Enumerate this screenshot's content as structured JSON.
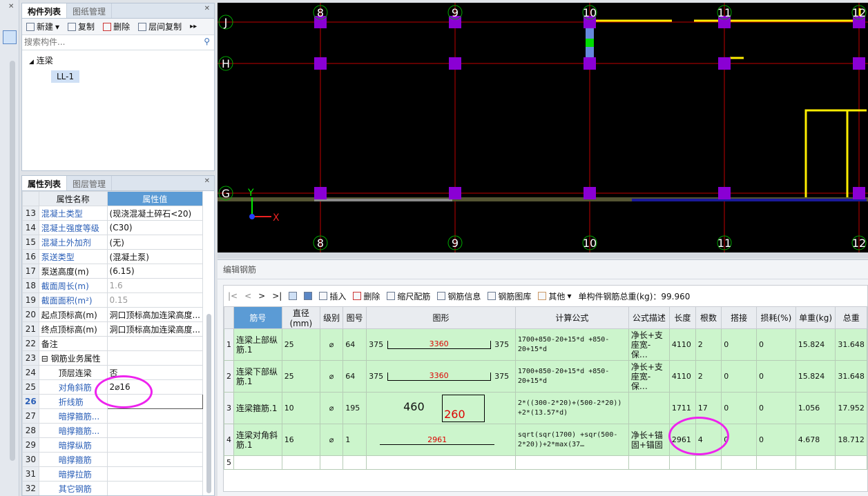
{
  "top_strip": {
    "close_label": "✕"
  },
  "component_panel": {
    "tabs": [
      "构件列表",
      "图纸管理"
    ],
    "toolbar": {
      "new": "新建",
      "copy": "复制",
      "delete": "删除",
      "floor_copy": "层间复制"
    },
    "search_placeholder": "搜索构件...",
    "tree": {
      "root": "连梁",
      "child": "LL-1"
    }
  },
  "property_panel": {
    "tabs": [
      "属性列表",
      "图层管理"
    ],
    "headers": [
      "属性名称",
      "属性值"
    ],
    "rows": [
      {
        "n": "13",
        "name": "混凝土类型",
        "value": "(现浇混凝土碎石<20)"
      },
      {
        "n": "14",
        "name": "混凝土强度等级",
        "value": "(C30)"
      },
      {
        "n": "15",
        "name": "混凝土外加剂",
        "value": "(无)"
      },
      {
        "n": "16",
        "name": "泵送类型",
        "value": "(混凝土泵)"
      },
      {
        "n": "17",
        "name": "泵送高度(m)",
        "value": "(6.15)"
      },
      {
        "n": "18",
        "name": "截面周长(m)",
        "value": "1.6"
      },
      {
        "n": "19",
        "name": "截面面积(m²)",
        "value": "0.15"
      },
      {
        "n": "20",
        "name": "起点顶标高(m)",
        "value": "洞口顶标高加连梁高度..."
      },
      {
        "n": "21",
        "name": "终点顶标高(m)",
        "value": "洞口顶标高加连梁高度..."
      },
      {
        "n": "22",
        "name": "备注",
        "value": ""
      },
      {
        "n": "23",
        "name": "钢筋业务属性",
        "value": ""
      },
      {
        "n": "24",
        "name": "顶层连梁",
        "value": "否"
      },
      {
        "n": "25",
        "name": "对角斜筋",
        "value": "2⌀16"
      },
      {
        "n": "26",
        "name": "折线筋",
        "value": ""
      },
      {
        "n": "27",
        "name": "暗撑箍筋...",
        "value": ""
      },
      {
        "n": "28",
        "name": "暗撑箍筋...",
        "value": ""
      },
      {
        "n": "29",
        "name": "暗撑纵筋",
        "value": ""
      },
      {
        "n": "30",
        "name": "暗撑箍筋",
        "value": ""
      },
      {
        "n": "31",
        "name": "暗撑拉筋",
        "value": ""
      },
      {
        "n": "32",
        "name": "其它钢筋",
        "value": ""
      }
    ]
  },
  "canvas": {
    "col_labels": [
      "8",
      "9",
      "10",
      "11",
      "12"
    ],
    "row_labels": [
      "J",
      "H",
      "G"
    ],
    "axis_x": "X",
    "axis_y": "Y"
  },
  "rebar_editor": {
    "title": "编辑钢筋",
    "toolbar": {
      "insert": "插入",
      "delete": "删除",
      "scale": "缩尺配筋",
      "info": "钢筋信息",
      "library": "钢筋图库",
      "other": "其他",
      "total": "单构件钢筋总重(kg)：99.960"
    },
    "headers": [
      "筋号",
      "直径(mm)",
      "级别",
      "图号",
      "图形",
      "计算公式",
      "公式描述",
      "长度",
      "根数",
      "搭接",
      "损耗(%)",
      "单重(kg)",
      "总重"
    ],
    "rows": [
      {
        "n": "1",
        "name": "连梁上部纵筋.1",
        "dia": "25",
        "grade": "⌀",
        "fig": "64",
        "shape_l": "375",
        "shape_m": "3360",
        "shape_r": "375",
        "formula": "1700+850-20+15*d +850-20+15*d",
        "desc": "净长+支座宽-保…",
        "len": "4110",
        "count": "2",
        "lap": "0",
        "loss": "0",
        "unit": "15.824",
        "total": "31.648"
      },
      {
        "n": "2",
        "name": "连梁下部纵筋.1",
        "dia": "25",
        "grade": "⌀",
        "fig": "64",
        "shape_l": "375",
        "shape_m": "3360",
        "shape_r": "375",
        "formula": "1700+850-20+15*d +850-20+15*d",
        "desc": "净长+支座宽-保…",
        "len": "4110",
        "count": "2",
        "lap": "0",
        "loss": "0",
        "unit": "15.824",
        "total": "31.648"
      },
      {
        "n": "3",
        "name": "连梁箍筋.1",
        "dia": "10",
        "grade": "⌀",
        "fig": "195",
        "shape_l": "460",
        "shape_m": "260",
        "shape_r": "",
        "formula": "2*((300-2*20)+(500-2*20)) +2*(13.57*d)",
        "desc": "",
        "len": "1711",
        "count": "17",
        "lap": "0",
        "loss": "0",
        "unit": "1.056",
        "total": "17.952"
      },
      {
        "n": "4",
        "name": "连梁对角斜筋.1",
        "dia": "16",
        "grade": "⌀",
        "fig": "1",
        "shape_l": "",
        "shape_m": "2961",
        "shape_r": "",
        "formula": "sqrt(sqr(1700) +sqr(500-2*20))+2*max(37…",
        "desc": "净长+锚固+锚固",
        "len": "2961",
        "count": "4",
        "lap": "0",
        "loss": "0",
        "unit": "4.678",
        "total": "18.712"
      },
      {
        "n": "5",
        "name": "",
        "dia": "",
        "grade": "",
        "fig": "",
        "shape_l": "",
        "shape_m": "",
        "shape_r": "",
        "formula": "",
        "desc": "",
        "len": "",
        "count": "",
        "lap": "",
        "loss": "",
        "unit": "",
        "total": ""
      }
    ]
  },
  "colors": {
    "canvas_bg": "#000000",
    "grid_red": "#c00000",
    "column_purple": "#8a00d4",
    "wall_yellow": "#ffee00",
    "row_green": "#ccf5cc",
    "highlight_magenta": "#ee22ee"
  }
}
